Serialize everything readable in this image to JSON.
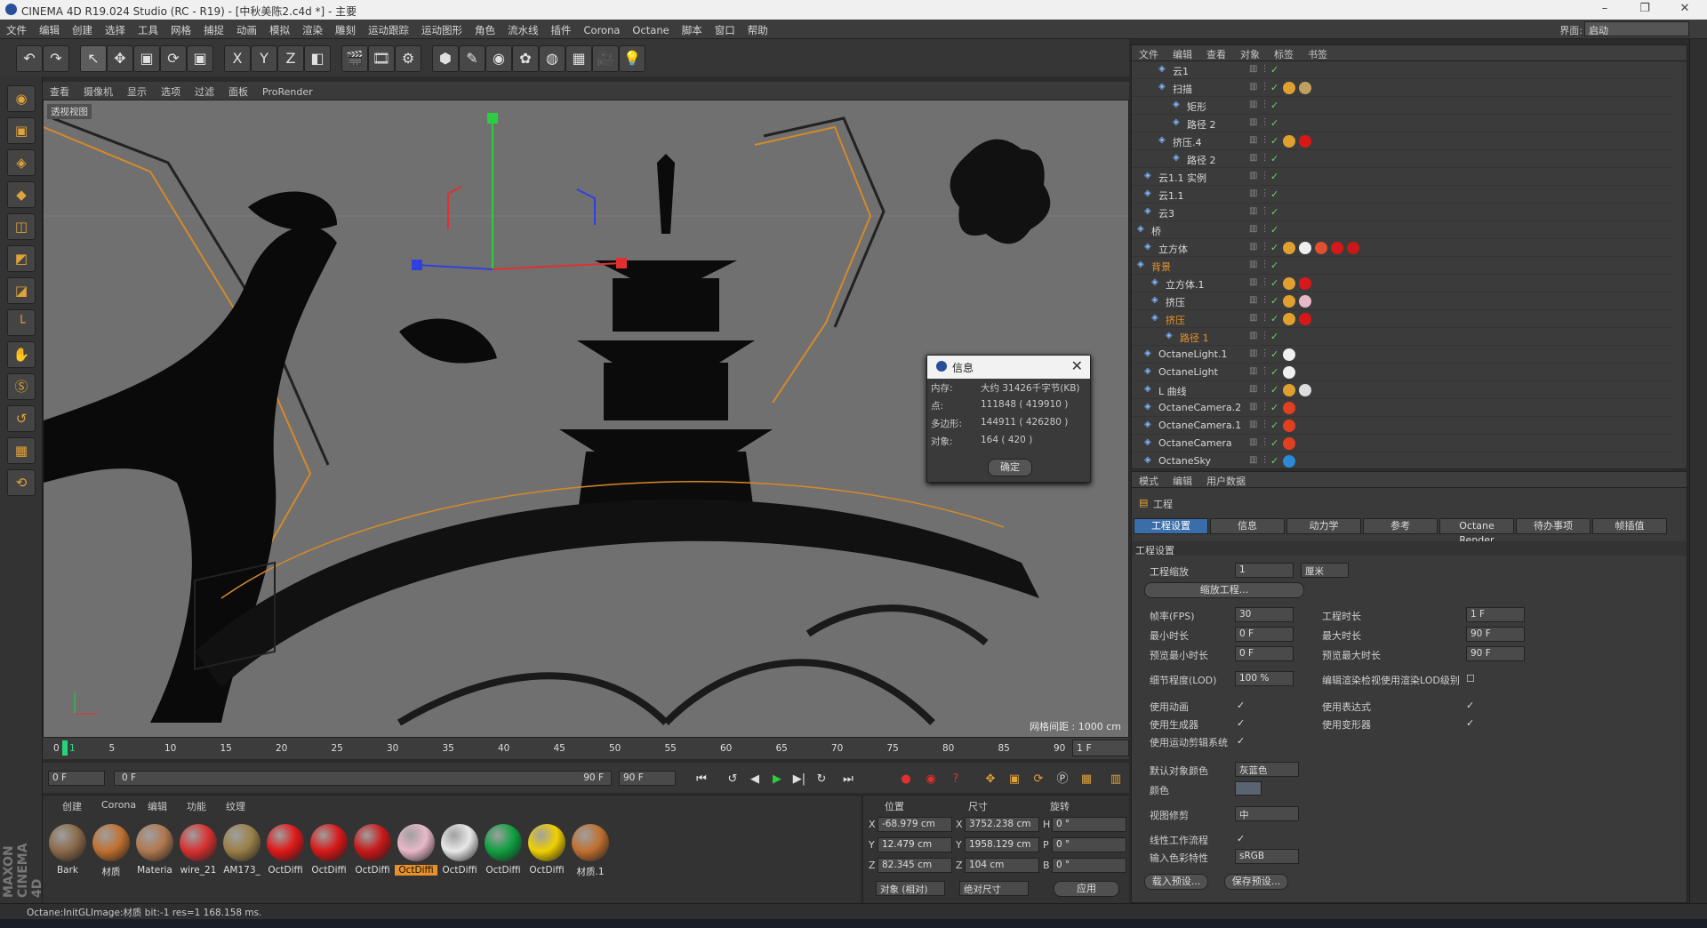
{
  "app_title": "CINEMA 4D R19.024 Studio (RC - R19) - [中秋美陈2.c4d *] - 主要",
  "menu": [
    "文件",
    "编辑",
    "创建",
    "选择",
    "工具",
    "网格",
    "捕捉",
    "动画",
    "模拟",
    "渲染",
    "雕刻",
    "运动跟踪",
    "运动图形",
    "角色",
    "流水线",
    "插件",
    "Corona",
    "Octane",
    "脚本",
    "窗口",
    "帮助"
  ],
  "layout": {
    "label": "界面:",
    "value": "启动"
  },
  "toolbar_icons": [
    "undo-icon",
    "redo-icon",
    "live-select-icon",
    "move-icon",
    "scale-icon",
    "rotate-icon",
    "scale-tool-icon",
    "x-axis-icon",
    "y-axis-icon",
    "z-axis-icon",
    "coordinate-system-icon",
    "render-view-icon",
    "render-picture-viewer-icon",
    "render-settings-icon",
    "cube-icon",
    "pen-icon",
    "subdivision-icon",
    "cloner-icon",
    "deformer-icon",
    "floor-icon",
    "camera-icon",
    "light-icon"
  ],
  "toolbar_glyphs": [
    "↶",
    "↷",
    "↖",
    "✥",
    "▣",
    "⟳",
    "▣",
    "X",
    "Y",
    "Z",
    "◧",
    "🎬",
    "🎞",
    "⚙",
    "⬢",
    "✎",
    "◉",
    "✿",
    "◍",
    "▦",
    "🎥",
    "💡"
  ],
  "left_tools": [
    "◉",
    "▣",
    "◈",
    "◆",
    "◫",
    "◩",
    "◪",
    "└",
    "✋",
    "Ⓢ",
    "↺",
    "▦",
    "⟲"
  ],
  "viewport": {
    "menu": [
      "查看",
      "摄像机",
      "显示",
      "选项",
      "过滤",
      "面板",
      "ProRender"
    ],
    "label": "透视视图",
    "grid_spacing": "网格间距 : 1000 cm"
  },
  "info_dialog": {
    "title": "信息",
    "rows": [
      {
        "k": "内存:",
        "v": "大约 31426千字节(KB)"
      },
      {
        "k": "点:",
        "v": "111848 ( 419910 )"
      },
      {
        "k": "多边形:",
        "v": "144911 ( 426280 )"
      },
      {
        "k": "对象:",
        "v": "164 ( 420 )"
      }
    ],
    "ok": "确定"
  },
  "timeline": {
    "ticks": [
      "0",
      "5",
      "10",
      "15",
      "20",
      "25",
      "30",
      "35",
      "40",
      "45",
      "50",
      "55",
      "60",
      "65",
      "70",
      "75",
      "80",
      "85",
      "90"
    ],
    "current": "1",
    "frame_field": "1 F",
    "start": "0 F",
    "slider_start": "0 F",
    "slider_end": "90 F",
    "end": "90 F"
  },
  "materials": {
    "menu": [
      "创建",
      "Corona",
      "编辑",
      "功能",
      "纹理"
    ],
    "items": [
      {
        "label": "Bark",
        "color": "#8a6a4a"
      },
      {
        "label": "材质",
        "color": "#c07030"
      },
      {
        "label": "Materia",
        "color": "#b07850"
      },
      {
        "label": "wire_21",
        "color": "#d83030"
      },
      {
        "label": "AM173_",
        "color": "#9a8048"
      },
      {
        "label": "OctDiffi",
        "color": "#e01818"
      },
      {
        "label": "OctDiffi",
        "color": "#d81818"
      },
      {
        "label": "OctDiffi",
        "color": "#c81818"
      },
      {
        "label": "OctDiffi",
        "color": "#e8b8c8"
      },
      {
        "label": "OctDiffi",
        "color": "#e8e8e8"
      },
      {
        "label": "OctDiffi",
        "color": "#10a040"
      },
      {
        "label": "OctDiffi",
        "color": "#f0d000"
      },
      {
        "label": "材质.1",
        "color": "#c07030"
      }
    ]
  },
  "coordinates": {
    "headers": [
      "位置",
      "尺寸",
      "旋转"
    ],
    "rows": [
      {
        "axis": "X",
        "pos": "-68.979 cm",
        "size_axis": "X",
        "size": "3752.238 cm",
        "rot_axis": "H",
        "rot": "0 °"
      },
      {
        "axis": "Y",
        "pos": "12.479 cm",
        "size_axis": "Y",
        "size": "1958.129 cm",
        "rot_axis": "P",
        "rot": "0 °"
      },
      {
        "axis": "Z",
        "pos": "82.345 cm",
        "size_axis": "Z",
        "size": "104 cm",
        "rot_axis": "B",
        "rot": "0 °"
      }
    ],
    "mode": "对象 (相对)",
    "size_mode": "绝对尺寸",
    "apply": "应用"
  },
  "status": "Octane:InitGLImage:材质 bit:-1 res=1 168.158 ms.",
  "object_manager": {
    "menu": [
      "文件",
      "编辑",
      "查看",
      "对象",
      "标签",
      "书签"
    ],
    "rows": [
      {
        "name": "云1",
        "org": false,
        "tags": []
      },
      {
        "name": "扫描",
        "org": false,
        "tags": [
          "#e0a030",
          "#c0a060"
        ]
      },
      {
        "name": "矩形",
        "org": false,
        "tags": []
      },
      {
        "name": "路径 2",
        "org": false,
        "tags": []
      },
      {
        "name": "挤压.4",
        "org": false,
        "tags": [
          "#e0a030",
          "#d81818"
        ]
      },
      {
        "name": "路径 2",
        "org": false,
        "tags": []
      },
      {
        "name": "云1.1 实例",
        "org": false,
        "tags": []
      },
      {
        "name": "云1.1",
        "org": false,
        "tags": []
      },
      {
        "name": "云3",
        "org": false,
        "tags": []
      },
      {
        "name": "桥",
        "org": false,
        "tags": []
      },
      {
        "name": "立方体",
        "org": false,
        "tags": [
          "#e0a030",
          "#eeeeee",
          "#e05030",
          "#d81818",
          "#c81818"
        ]
      },
      {
        "name": "背景",
        "org": true,
        "tags": []
      },
      {
        "name": "立方体.1",
        "org": false,
        "tags": [
          "#e0a030",
          "#d81818"
        ]
      },
      {
        "name": "挤压",
        "org": false,
        "tags": [
          "#e0a030",
          "#e8b8c8"
        ]
      },
      {
        "name": "挤压",
        "org": true,
        "tags": [
          "#e0a030",
          "#d81818"
        ]
      },
      {
        "name": "路径 1",
        "org": true,
        "tags": []
      },
      {
        "name": "OctaneLight.1",
        "org": false,
        "tags": [
          "#f0f0f0"
        ]
      },
      {
        "name": "OctaneLight",
        "org": false,
        "tags": [
          "#f0f0f0"
        ]
      },
      {
        "name": "L 曲线",
        "org": false,
        "tags": [
          "#e0a030",
          "#dddddd"
        ]
      },
      {
        "name": "OctaneCamera.2",
        "org": false,
        "tags": [
          "#e04020"
        ]
      },
      {
        "name": "OctaneCamera.1",
        "org": false,
        "tags": [
          "#e04020"
        ]
      },
      {
        "name": "OctaneCamera",
        "org": false,
        "tags": [
          "#e04020"
        ]
      },
      {
        "name": "OctaneSky",
        "org": false,
        "tags": [
          "#2a8ad8"
        ]
      }
    ]
  },
  "attributes": {
    "menu": [
      "模式",
      "编辑",
      "用户数据"
    ],
    "title": "工程",
    "tabs": [
      "工程设置",
      "信息",
      "动力学",
      "参考",
      "Octane Render",
      "待办事项",
      "帧插值"
    ],
    "section": "工程设置",
    "scale_label": "工程缩放",
    "scale_value": "1",
    "scale_unit": "厘米",
    "scale_btn": "缩放工程...",
    "fps_label": "帧率(FPS)",
    "fps": "30",
    "duration_label": "工程时长",
    "duration": "1 F",
    "min_label": "最小时长",
    "min": "0 F",
    "max_label": "最大时长",
    "max": "90 F",
    "pmin_label": "预览最小时长",
    "pmin": "0 F",
    "pmax_label": "预览最大时长",
    "pmax": "90 F",
    "lod_label": "细节程度(LOD)",
    "lod": "100 %",
    "lod_render_label": "编辑渲染检视使用渲染LOD级别",
    "use_anim": "使用动画",
    "use_expr": "使用表达式",
    "use_gen": "使用生成器",
    "use_deform": "使用变形器",
    "use_motion": "使用运动剪辑系统",
    "obj_color_label": "默认对象颜色",
    "obj_color": "灰蓝色",
    "color_label": "颜色",
    "clip_label": "视图修剪",
    "clip": "中",
    "linear_label": "线性工作流程",
    "input_color_label": "输入色彩特性",
    "input_color": "sRGB",
    "load_preset": "载入预设...",
    "save_preset": "保存预设..."
  }
}
